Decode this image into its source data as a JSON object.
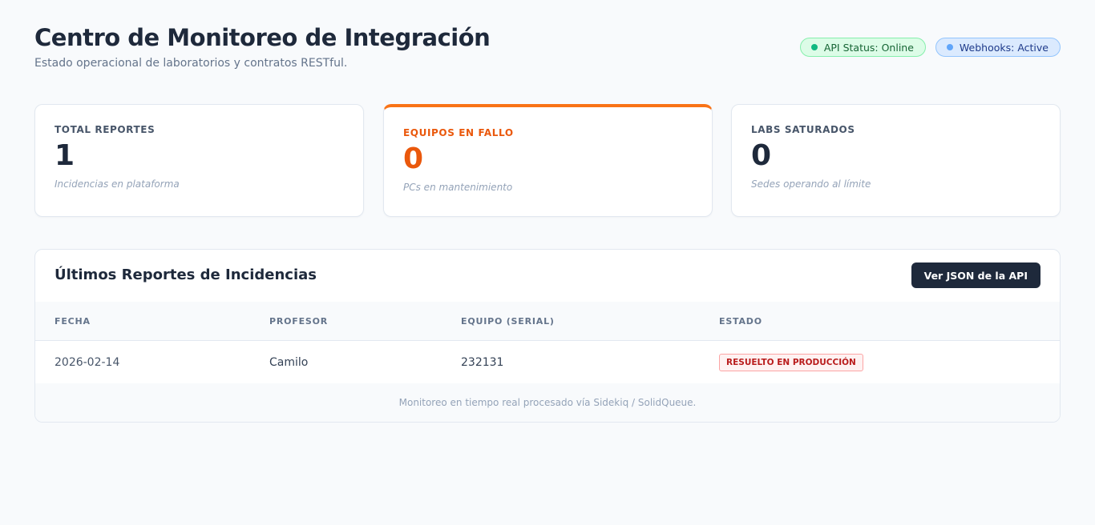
{
  "header": {
    "title": "Centro de Monitoreo de Integración",
    "subtitle": "Estado operacional de laboratorios y contratos RESTful."
  },
  "badges": {
    "api": "API Status: Online",
    "webhooks": "Webhooks: Active"
  },
  "stats": [
    {
      "label": "TOTAL REPORTES",
      "value": "1",
      "note": "Incidencias en plataforma"
    },
    {
      "label": "EQUIPOS EN FALLO",
      "value": "0",
      "note": "PCs en mantenimiento"
    },
    {
      "label": "LABS SATURADOS",
      "value": "0",
      "note": "Sedes operando al límite"
    }
  ],
  "reports": {
    "title": "Últimos Reportes de Incidencias",
    "api_button": "Ver JSON de la API",
    "columns": [
      "FECHA",
      "PROFESOR",
      "EQUIPO (SERIAL)",
      "ESTADO"
    ],
    "rows": [
      {
        "fecha": "2026-02-14",
        "profesor": "Camilo",
        "equipo": "232131",
        "estado": "RESUELTO EN PRODUCCIÓN"
      }
    ],
    "footer": "Monitoreo en tiempo real procesado vía Sidekiq / SolidQueue."
  },
  "colors": {
    "accent_orange": "#f97316",
    "status_online": "#10b981",
    "status_active": "#60a5fa",
    "button_dark": "#1e293b",
    "status_resolved": "#b91c1c"
  }
}
